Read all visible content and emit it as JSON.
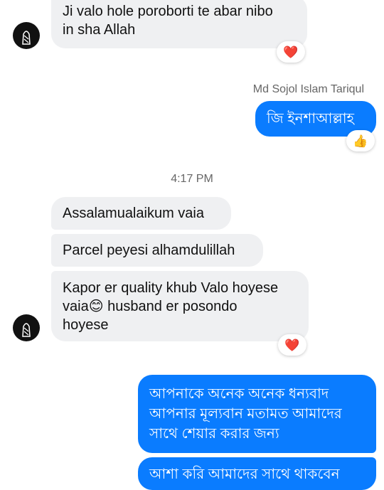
{
  "messages": {
    "m1": {
      "text": "Ji valo hole poroborti te abar nibo\nin sha Allah",
      "reaction": "❤️"
    },
    "sender_name": "Md Sojol Islam Tariqul",
    "m2": {
      "text": "জি ইনশাআল্লাহ",
      "reaction": "👍"
    },
    "timestamp": "4:17 PM",
    "m3": {
      "text": "Assalamualaikum vaia"
    },
    "m4": {
      "text": "Parcel peyesi alhamdulillah"
    },
    "m5": {
      "text": "Kapor er quality khub Valo hoyese\nvaia😊 husband er posondo\nhoyese",
      "reaction": "❤️"
    },
    "m6": {
      "text": "আপনাকে অনেক অনেক ধন্যবাদ\nআপনার মূল্যবান মতামত আমাদের\nসাথে শেয়ার করার জন্য"
    },
    "m7": {
      "text": "আশা করি আমাদের সাথে থাকবেন"
    }
  },
  "colors": {
    "incoming_bubble": "#eff0f2",
    "outgoing_bubble": "#0a7cff",
    "meta_text": "#666666"
  },
  "icons": {
    "avatar": "person-silhouette-avatar",
    "heart_reaction": "heart-icon",
    "like_reaction": "thumbs-up-icon"
  }
}
